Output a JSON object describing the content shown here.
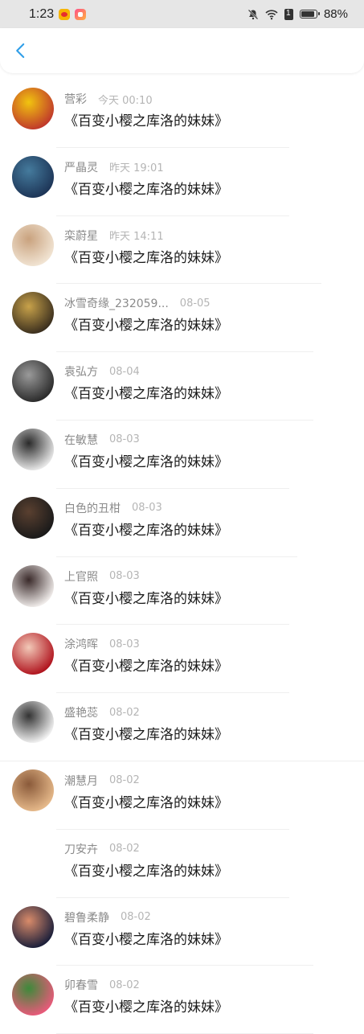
{
  "status_bar": {
    "time": "1:23",
    "battery_text": "88%",
    "battery_level": 0.88,
    "app_icons": [
      "weibo-icon",
      "app-store-icon"
    ],
    "right_icons": [
      "bell-muted-icon",
      "wifi-icon",
      "sim-icon",
      "battery-icon"
    ]
  },
  "nav": {
    "back_icon": "chevron-left-icon",
    "accent": "#2f9ee8"
  },
  "items": [
    {
      "name": "营彩",
      "time": "今天 00:10",
      "message": "《百变小樱之库洛的妹妹》",
      "avatar_colors": [
        "#c0392b",
        "#f1c40f"
      ]
    },
    {
      "name": "严晶灵",
      "time": "昨天 19:01",
      "message": "《百变小樱之库洛的妹妹》",
      "avatar_colors": [
        "#1d3557",
        "#457b9d"
      ]
    },
    {
      "name": "栾蔚星",
      "time": "昨天 14:11",
      "message": "《百变小樱之库洛的妹妹》",
      "avatar_colors": [
        "#f1e4d3",
        "#c9a27e"
      ]
    },
    {
      "name": "冰雪奇缘_232059...",
      "time": "08-05",
      "message": "《百变小樱之库洛的妹妹》",
      "avatar_colors": [
        "#3b2f1e",
        "#c8a24a"
      ]
    },
    {
      "name": "袁弘方",
      "time": "08-04",
      "message": "《百变小樱之库洛的妹妹》",
      "avatar_colors": [
        "#2b2b2b",
        "#9a9a9a"
      ]
    },
    {
      "name": "在敏慧",
      "time": "08-03",
      "message": "《百变小樱之库洛的妹妹》",
      "avatar_colors": [
        "#e8e8e8",
        "#2a2a2a"
      ]
    },
    {
      "name": "白色的丑柑",
      "time": "08-03",
      "message": "《百变小樱之库洛的妹妹》",
      "avatar_colors": [
        "#1a1a1a",
        "#5a4030"
      ]
    },
    {
      "name": "上官照",
      "time": "08-03",
      "message": "《百变小樱之库洛的妹妹》",
      "avatar_colors": [
        "#f0ecea",
        "#3a2a2a"
      ]
    },
    {
      "name": "涂鸿晖",
      "time": "08-03",
      "message": "《百变小樱之库洛的妹妹》",
      "avatar_colors": [
        "#b0141e",
        "#f2c9b8"
      ]
    },
    {
      "name": "盛艳蕊",
      "time": "08-02",
      "message": "《百变小樱之库洛的妹妹》",
      "avatar_colors": [
        "#f2f2f2",
        "#333333"
      ]
    },
    {
      "name": "潮慧月",
      "time": "08-02",
      "message": "《百变小樱之库洛的妹妹》",
      "avatar_colors": [
        "#e6b98a",
        "#8a5a3a"
      ]
    },
    {
      "name": "刀安卉",
      "time": "08-02",
      "message": "《百变小樱之库洛的妹妹》",
      "avatar_colors": [
        "#ffffff",
        "#ffffff"
      ]
    },
    {
      "name": "碧鲁柔静",
      "time": "08-02",
      "message": "《百变小樱之库洛的妹妹》",
      "avatar_colors": [
        "#1b1f3a",
        "#d98b6a"
      ]
    },
    {
      "name": "卯春雪",
      "time": "08-02",
      "message": "《百变小樱之库洛的妹妹》",
      "avatar_colors": [
        "#e85a7a",
        "#3d8a3a"
      ]
    }
  ]
}
